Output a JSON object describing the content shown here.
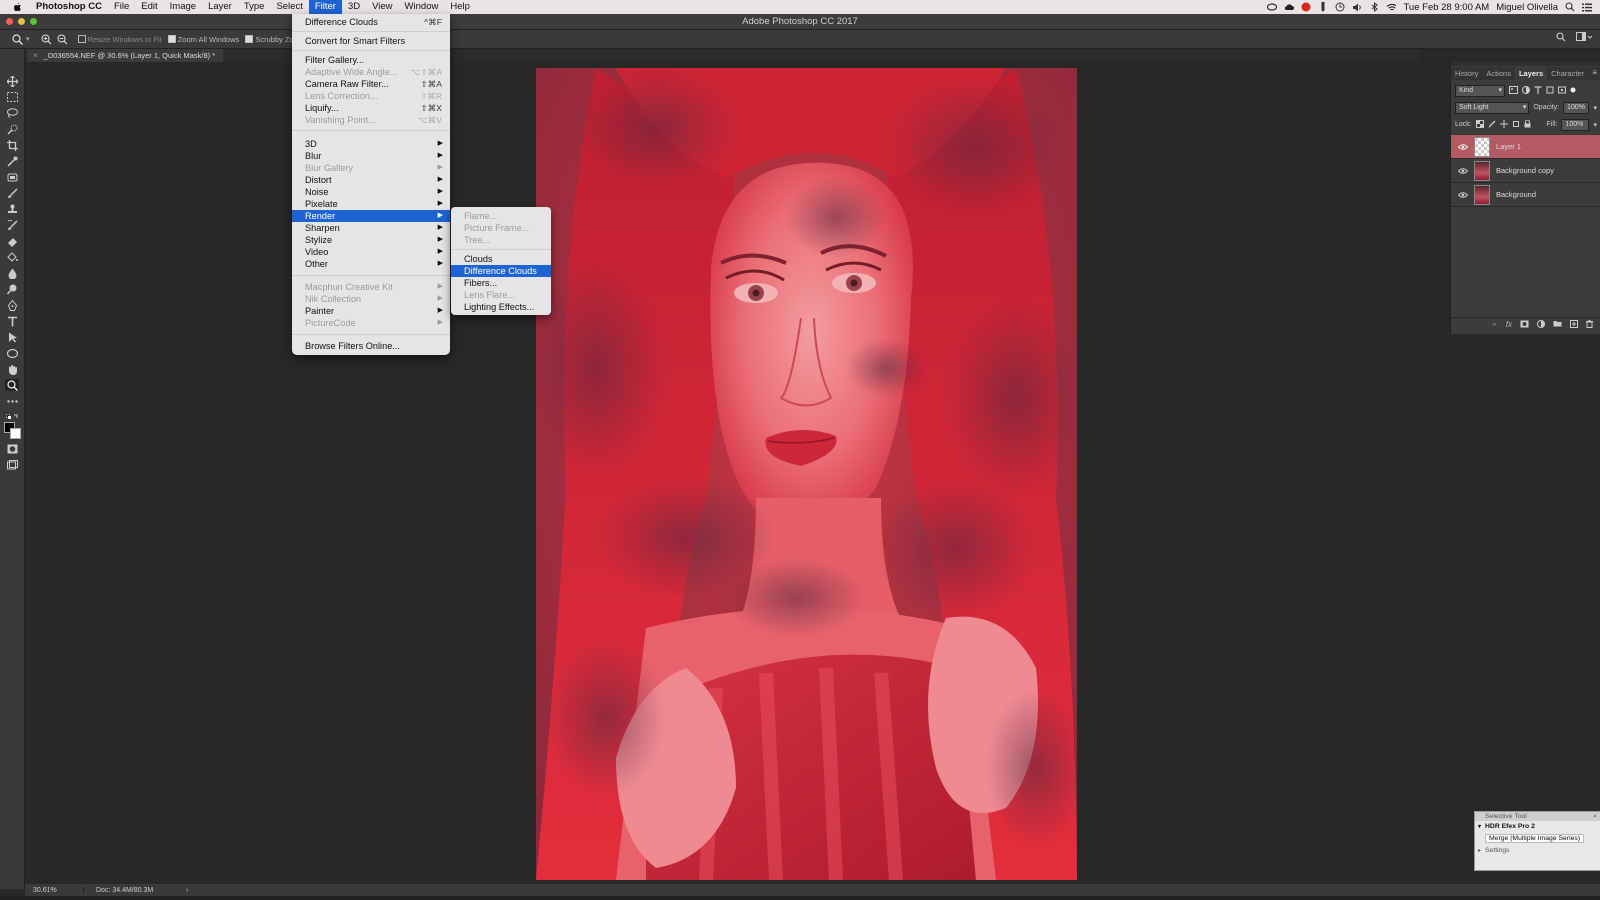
{
  "menubar": {
    "app": "Photoshop CC",
    "items": [
      "File",
      "Edit",
      "Image",
      "Layer",
      "Type",
      "Select",
      "Filter",
      "3D",
      "View",
      "Window",
      "Help"
    ],
    "active": "Filter",
    "datetime": "Tue Feb 28  9:00 AM",
    "user": "Miguel Olivella"
  },
  "titlebar": {
    "title": "Adobe Photoshop CC 2017"
  },
  "optionsbar": {
    "resize_label": "Resize Windows to Fit",
    "zoom_all_label": "Zoom All Windows",
    "scrubby_label": "Scrubby Zoom"
  },
  "document": {
    "tab_title": "_D036554.NEF @ 30.6% (Layer 1, Quick Mask/8) *"
  },
  "status": {
    "zoom": "30.61%",
    "doc": "Doc: 34.4M/80.3M"
  },
  "filter_menu": {
    "items": [
      {
        "label": "Difference Clouds",
        "shortcut": "^⌘F"
      },
      {
        "label": "Convert for Smart Filters"
      },
      {
        "label": "Filter Gallery..."
      },
      {
        "label": "Adaptive Wide Angle...",
        "shortcut": "⌥⇧⌘A",
        "disabled": true
      },
      {
        "label": "Camera Raw Filter...",
        "shortcut": "⇧⌘A"
      },
      {
        "label": "Lens Correction...",
        "shortcut": "⇧⌘R",
        "disabled": true
      },
      {
        "label": "Liquify...",
        "shortcut": "⇧⌘X"
      },
      {
        "label": "Vanishing Point...",
        "shortcut": "⌥⌘V",
        "disabled": true
      },
      {
        "label": "3D",
        "submenu": true
      },
      {
        "label": "Blur",
        "submenu": true
      },
      {
        "label": "Blur Gallery",
        "submenu": true,
        "disabled": true
      },
      {
        "label": "Distort",
        "submenu": true
      },
      {
        "label": "Noise",
        "submenu": true
      },
      {
        "label": "Pixelate",
        "submenu": true
      },
      {
        "label": "Render",
        "submenu": true,
        "selected": true
      },
      {
        "label": "Sharpen",
        "submenu": true
      },
      {
        "label": "Stylize",
        "submenu": true
      },
      {
        "label": "Video",
        "submenu": true
      },
      {
        "label": "Other",
        "submenu": true
      },
      {
        "label": "Macphun Creative Kit",
        "submenu": true,
        "disabled": true
      },
      {
        "label": "Nik Collection",
        "submenu": true,
        "disabled": true
      },
      {
        "label": "Painter",
        "submenu": true
      },
      {
        "label": "PictureCode",
        "submenu": true,
        "disabled": true
      },
      {
        "label": "Browse Filters Online..."
      }
    ]
  },
  "render_submenu": {
    "items": [
      {
        "label": "Flame...",
        "disabled": true
      },
      {
        "label": "Picture Frame...",
        "disabled": true
      },
      {
        "label": "Tree...",
        "disabled": true
      },
      {
        "label": "Clouds"
      },
      {
        "label": "Difference Clouds",
        "selected": true
      },
      {
        "label": "Fibers..."
      },
      {
        "label": "Lens Flare...",
        "disabled": true
      },
      {
        "label": "Lighting Effects..."
      }
    ]
  },
  "layers_panel": {
    "tabs": [
      "History",
      "Actions",
      "Layers",
      "Character"
    ],
    "active_tab": "Layers",
    "filter_kind": "Kind",
    "blend_mode": "Soft Light",
    "opacity_label": "Opacity:",
    "opacity": "100%",
    "lock_label": "Lock:",
    "fill_label": "Fill:",
    "fill": "100%",
    "layers": [
      {
        "name": "Layer 1",
        "active": true
      },
      {
        "name": "Background copy"
      },
      {
        "name": "Background"
      }
    ]
  },
  "selective_tool": {
    "title": "Selective Tool",
    "item": "HDR Efex Pro 2",
    "button": "Merge (Multiple Image Series)",
    "settings": "Settings"
  },
  "colors": {
    "menu_highlight": "#1e63d3",
    "active_layer": "#b35a63",
    "overlay_red": "#e23440"
  }
}
